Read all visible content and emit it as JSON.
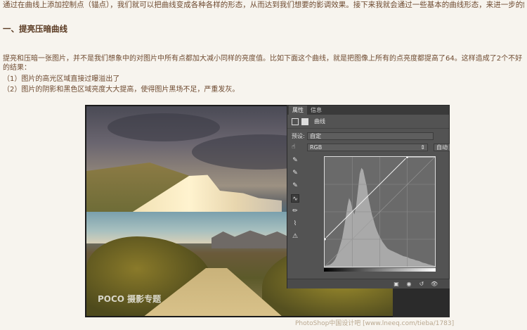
{
  "intro": "通过在曲线上添加控制点（锚点），我们就可以把曲线变成各种各样的形态，从而达到我们想要的影调效果。接下来我就会通过一些基本的曲线形态，来进一步的解释曲线。",
  "section_heading": "一、提亮压暗曲线",
  "paragraph": "提亮和压暗一张图片，并不是我们想象中的对图片中所有点都加大减小同样的亮度值。比如下面这个曲线，就是把图像上所有的点亮度都提高了64。这样造成了2个不好的结果：",
  "list": [
    "（1）图片的高光区域直接过曝溢出了",
    "（2）图片的阴影和黑色区域亮度大大提高，使得图片黑场不足，严重发灰。"
  ],
  "photo_watermark": "POCO 摄影专题",
  "panel": {
    "tabs": [
      "属性",
      "信息"
    ],
    "title": "曲线",
    "preset_label": "预设:",
    "preset_value": "自定",
    "channel_value": "RGB",
    "auto_label": "自动",
    "tools": [
      "eyedropper-black",
      "eyedropper-gray",
      "eyedropper-white",
      "curve-point",
      "pencil",
      "smooth",
      "clipping-warning"
    ]
  },
  "footer_credit": "PhotoShop中国设计吧 [www.lneeq.com/tieba/1783]",
  "colors": {
    "text": "#6e4a30",
    "panel_bg": "#535353",
    "panel_dark": "#3a3a3a"
  },
  "chart_data": {
    "type": "line",
    "title": "",
    "xlabel": "",
    "ylabel": "",
    "xlim": [
      0,
      255
    ],
    "ylim": [
      0,
      255
    ],
    "grid": true,
    "series": [
      {
        "x": [
          0,
          191,
          255
        ],
        "y": [
          64,
          255,
          255
        ]
      }
    ],
    "histogram": [
      2,
      3,
      4,
      5,
      8,
      12,
      18,
      28,
      40,
      55,
      70,
      95,
      120,
      150,
      170,
      160,
      140,
      130,
      150,
      190,
      230,
      245,
      240,
      220,
      200,
      170,
      150,
      130,
      115,
      100,
      88,
      78,
      70,
      62,
      56,
      50,
      45,
      42,
      40,
      38,
      36,
      34,
      32,
      30,
      28,
      26,
      25,
      24,
      22,
      20,
      19,
      18,
      16,
      15,
      14,
      12,
      10,
      9,
      8,
      6,
      5,
      4,
      3,
      2
    ]
  }
}
